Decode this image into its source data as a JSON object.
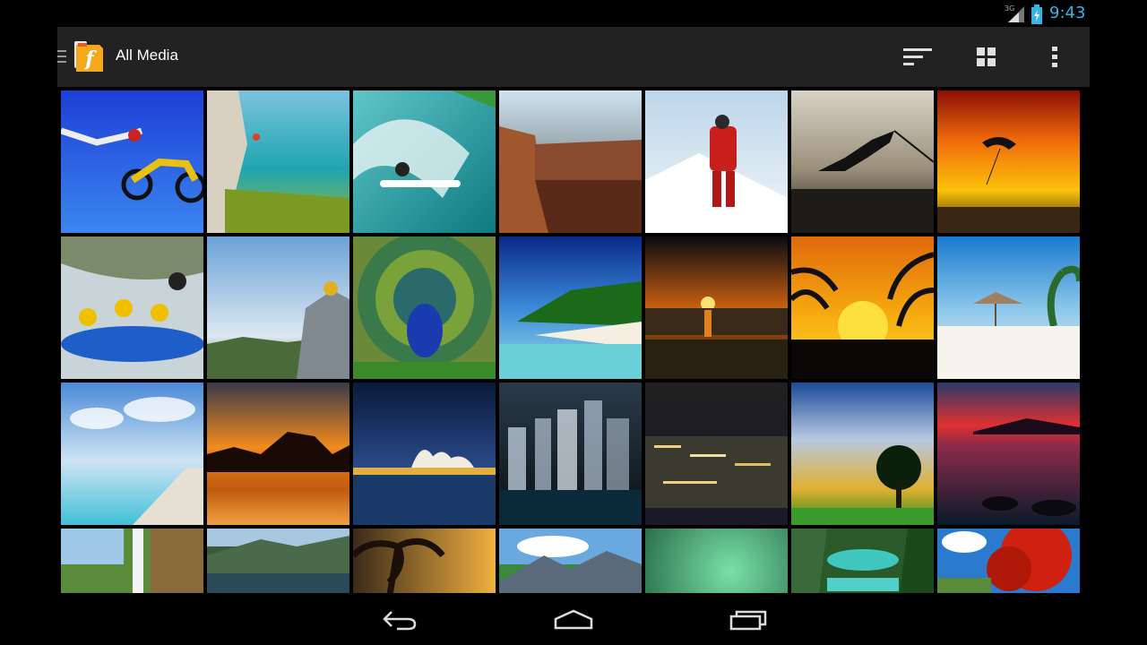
{
  "status_bar": {
    "network": "3G",
    "time": "9:43",
    "accent": "#33b5e5"
  },
  "action_bar": {
    "title": "All Media",
    "icons": [
      "drawer-icon",
      "app-logo-icon",
      "sort-icon",
      "grid-view-icon",
      "overflow-menu-icon"
    ]
  },
  "gallery": {
    "items": [
      {
        "subject": "motocross jump"
      },
      {
        "subject": "cliff climber over sea"
      },
      {
        "subject": "surfer in wave"
      },
      {
        "subject": "canyon overlook"
      },
      {
        "subject": "mountaineer in snow"
      },
      {
        "subject": "bungee jump silhouette"
      },
      {
        "subject": "paraglider at sunset"
      },
      {
        "subject": "white water rafting"
      },
      {
        "subject": "rock climber"
      },
      {
        "subject": "peacock"
      },
      {
        "subject": "tropical beach"
      },
      {
        "subject": "sunset over sea"
      },
      {
        "subject": "palm tree sunset"
      },
      {
        "subject": "beach umbrella"
      },
      {
        "subject": "pier to sea"
      },
      {
        "subject": "sunset rocks"
      },
      {
        "subject": "opera house"
      },
      {
        "subject": "city skyline night"
      },
      {
        "subject": "city lights"
      },
      {
        "subject": "tree landscape"
      },
      {
        "subject": "red sky lake"
      },
      {
        "subject": "waterfall"
      },
      {
        "subject": "mountain lake"
      },
      {
        "subject": "palm sunset"
      },
      {
        "subject": "green mountains"
      },
      {
        "subject": "green glow"
      },
      {
        "subject": "turquoise lake"
      },
      {
        "subject": "red autumn tree"
      }
    ]
  },
  "nav_bar": {
    "icons": [
      "back-icon",
      "home-icon",
      "recent-apps-icon"
    ]
  }
}
